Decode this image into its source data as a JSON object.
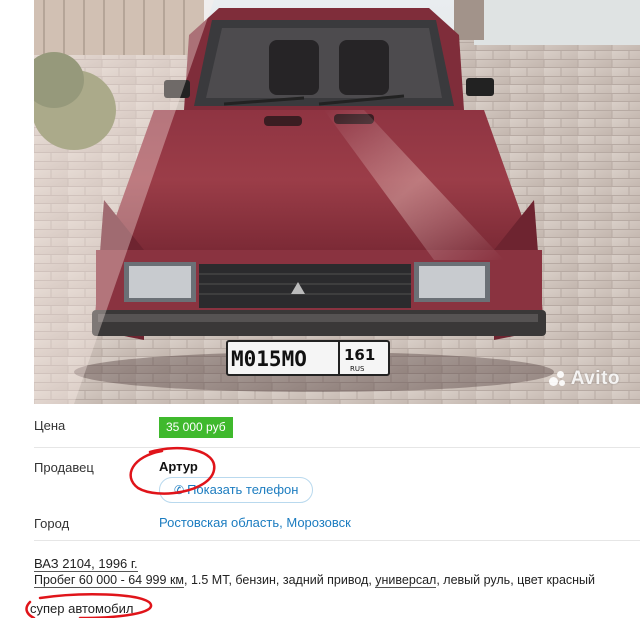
{
  "photo": {
    "alt": "ВАЗ 2104 red hatchback on paving stones",
    "plate_main": "М015МО",
    "plate_region": "161",
    "plate_country": "RUS",
    "watermark_text": "Avito"
  },
  "details": {
    "price_label": "Цена",
    "price_value": "35 000 руб",
    "seller_label": "Продавец",
    "seller_name": "Артур",
    "phone_button_label": "Показать телефон",
    "city_label": "Город",
    "city_value": "Ростовская область, Морозовск"
  },
  "specs": {
    "model_year": "ВАЗ 2104, 1996 г.",
    "mileage": "Пробег 60 000 - 64 999 км",
    "rest_1": ", 1.5 MT, бензин, задний привод, ",
    "body": "универсал",
    "rest_2": ", левый руль, цвет красный"
  },
  "description": "супер автомобил",
  "colors": {
    "price_green": "#3fb92d",
    "link_blue": "#1b7cc0",
    "annotation_red": "#e0141a"
  }
}
